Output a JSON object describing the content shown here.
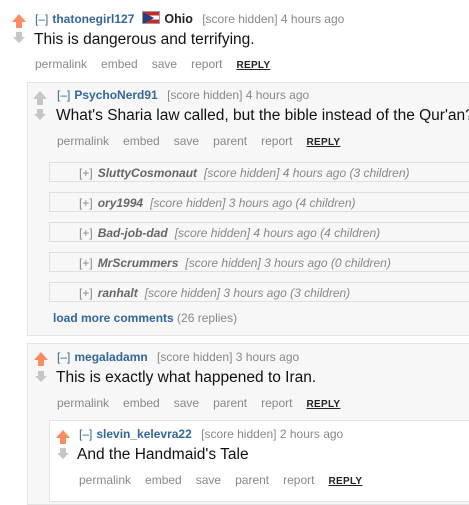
{
  "comments": [
    {
      "toggle": "[–]",
      "author": "thatonegirl127",
      "flair": "Ohio",
      "score": "[score hidden]",
      "time": "4 hours ago",
      "body": "This is dangerous and terrifying.",
      "actions": [
        "permalink",
        "embed",
        "save",
        "report"
      ],
      "reply": "REPLY"
    },
    {
      "toggle": "[–]",
      "author": "PsychoNerd91",
      "score": "[score hidden]",
      "time": "4 hours ago",
      "body": "What's Sharia law called, but the bible instead of the Qur'an?",
      "actions": [
        "permalink",
        "embed",
        "save",
        "parent",
        "report"
      ],
      "reply": "REPLY"
    },
    {
      "toggle": "[–]",
      "author": "megaladamn",
      "score": "[score hidden]",
      "time": "3 hours ago",
      "body": "This is exactly what happened to Iran.",
      "actions": [
        "permalink",
        "embed",
        "save",
        "parent",
        "report"
      ],
      "reply": "REPLY"
    },
    {
      "toggle": "[–]",
      "author": "slevin_kelevra22",
      "score": "[score hidden]",
      "time": "2 hours ago",
      "body": "And the Handmaid's Tale",
      "actions": [
        "permalink",
        "embed",
        "save",
        "parent",
        "report"
      ],
      "reply": "REPLY"
    }
  ],
  "collapsed": [
    {
      "toggle": "[+]",
      "author": "SluttyCosmonaut",
      "info": "[score hidden] 4 hours ago (3 children)"
    },
    {
      "toggle": "[+]",
      "author": "ory1994",
      "info": "[score hidden] 3 hours ago (4 children)"
    },
    {
      "toggle": "[+]",
      "author": "Bad-job-dad",
      "info": "[score hidden] 4 hours ago (4 children)"
    },
    {
      "toggle": "[+]",
      "author": "MrScrummers",
      "info": "[score hidden] 3 hours ago (0 children)"
    },
    {
      "toggle": "[+]",
      "author": "ranhalt",
      "info": "[score hidden] 3 hours ago (3 children)"
    }
  ],
  "load_more": {
    "label": "load more comments",
    "count": "(26 replies)"
  },
  "colors": {
    "upvote": "#ff8b60",
    "link": "#336699",
    "panel": "#f7f7f8"
  }
}
